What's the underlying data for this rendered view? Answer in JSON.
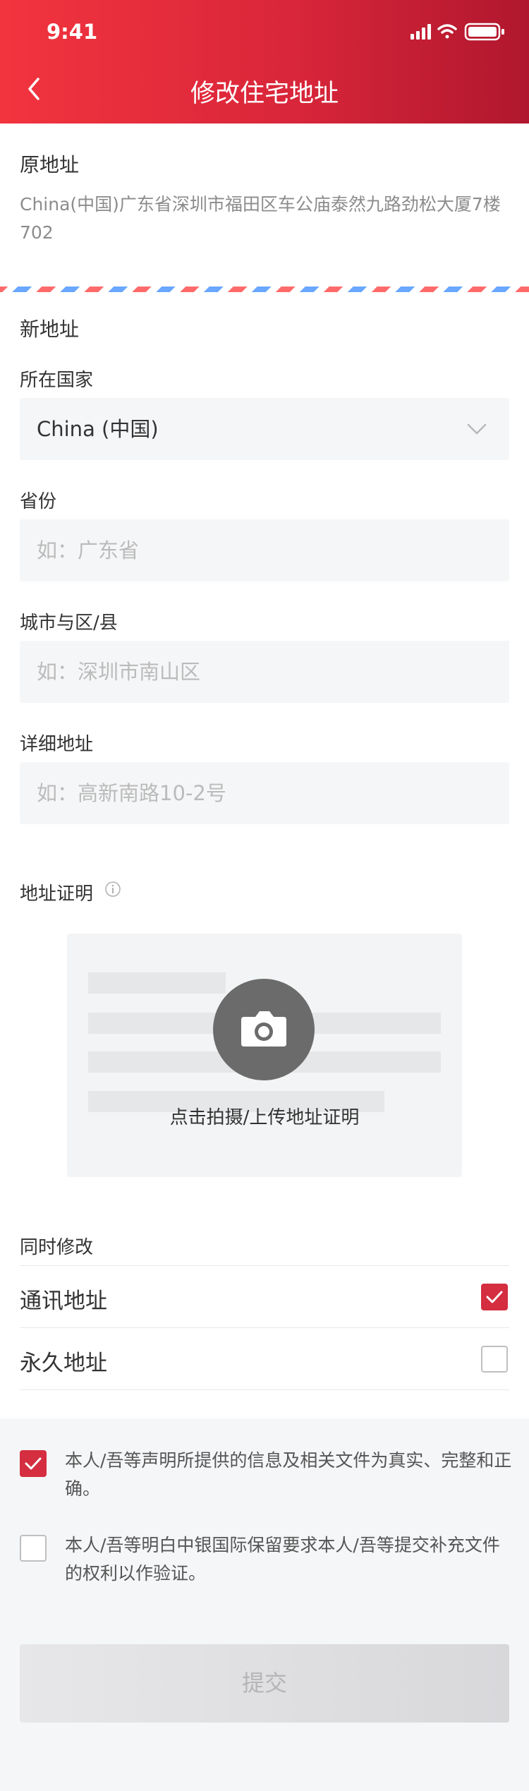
{
  "status_bar": {
    "time": "9:41"
  },
  "nav": {
    "title": "修改住宅地址"
  },
  "original_address": {
    "title": "原地址",
    "text": "China(中国)广东省深圳市福田区车公庙泰然九路劲松大厦7楼702"
  },
  "new_address": {
    "title": "新地址",
    "country": {
      "label": "所在国家",
      "value": "China (中国)"
    },
    "province": {
      "label": "省份",
      "placeholder": "如：广东省"
    },
    "city": {
      "label": "城市与区/县",
      "placeholder": "如：深圳市南山区"
    },
    "detail": {
      "label": "详细地址",
      "placeholder": "如：高新南路10-2号"
    }
  },
  "proof": {
    "title": "地址证明",
    "upload_label": "点击拍摄/上传地址证明"
  },
  "also_modify": {
    "title": "同时修改",
    "options": [
      {
        "label": "通讯地址",
        "checked": true
      },
      {
        "label": "永久地址",
        "checked": false
      }
    ]
  },
  "declarations": [
    {
      "text": "本人/吾等声明所提供的信息及相关文件为真实、完整和正确。",
      "checked": true
    },
    {
      "text": "本人/吾等明白中银国际保留要求本人/吾等提交补充文件的权利以作验证。",
      "checked": false
    }
  ],
  "submit_label": "提交",
  "colors": {
    "brand_red": "#e22c3c",
    "check_red": "#d42e40"
  }
}
